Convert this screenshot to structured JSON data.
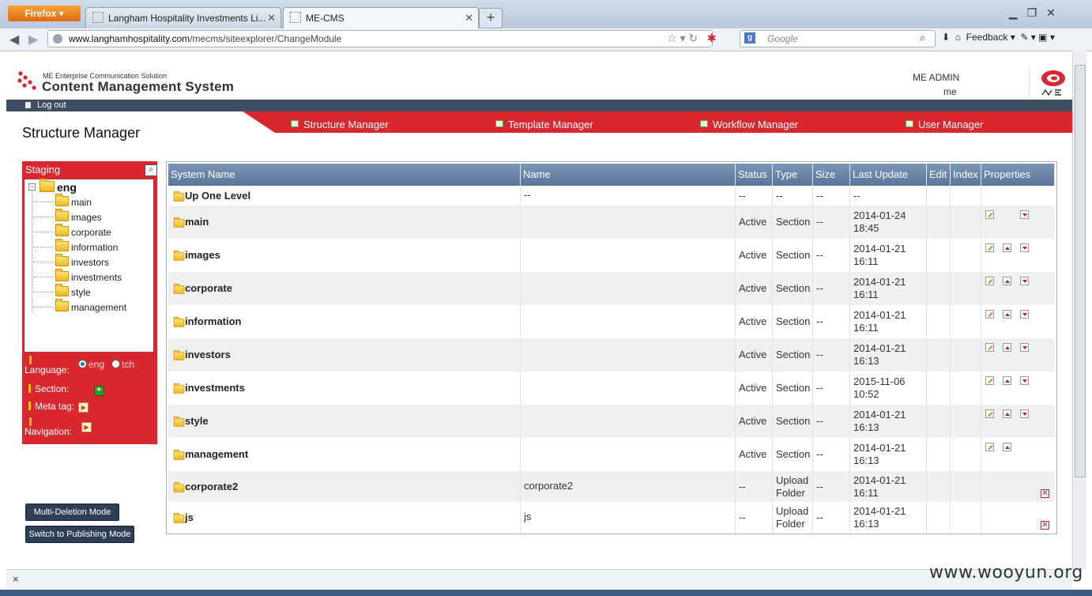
{
  "browser": {
    "firefox_label": "Firefox",
    "tabs": [
      {
        "label": "Langham Hospitality Investments Li..."
      },
      {
        "label": "ME-CMS"
      }
    ],
    "new_tab": "+",
    "url_host": "www.langhamhospitality.com",
    "url_path": "/mecms/siteexplorer/ChangeModule",
    "search_placeholder": "Google",
    "feedback": "Feedback"
  },
  "header": {
    "subtitle": "ME Enterprise Communication Solution",
    "title": "Content Management System",
    "user_name": "ME ADMIN",
    "user_id": "me",
    "logout": "Log out"
  },
  "nav": [
    {
      "label": "Structure Manager"
    },
    {
      "label": "Template Manager"
    },
    {
      "label": "Workflow Manager"
    },
    {
      "label": "User Manager"
    }
  ],
  "page_title": "Structure Manager",
  "staging": {
    "title": "Staging",
    "root": "eng",
    "children": [
      "main",
      "images",
      "corporate",
      "information",
      "investors",
      "investments",
      "style",
      "management"
    ],
    "language_label": "Language:",
    "lang_options": [
      "eng",
      "tch"
    ],
    "lang_selected": "eng",
    "section_label": "Section:",
    "metatag_label": "Meta tag:",
    "navigation_label": "Navigation:"
  },
  "buttons": {
    "multi_delete": "Multi-Deletion Mode",
    "switch_publish": "Switch to Publishing Mode"
  },
  "table": {
    "headers": [
      "System Name",
      "Name",
      "Status",
      "Type",
      "Size",
      "Last Update",
      "Edit",
      "Index",
      "Properties"
    ],
    "rows": [
      {
        "system": "Up One Level",
        "name": "--",
        "status": "--",
        "type": "--",
        "size": "--",
        "date": "--",
        "time": "",
        "props": []
      },
      {
        "system": "main",
        "name": "",
        "status": "Active",
        "type": "Section",
        "size": "--",
        "date": "2014-01-24",
        "time": "18:45",
        "props": [
          "edit",
          "down"
        ]
      },
      {
        "system": "images",
        "name": "",
        "status": "Active",
        "type": "Section",
        "size": "--",
        "date": "2014-01-21",
        "time": "16:11",
        "props": [
          "edit",
          "up",
          "down"
        ]
      },
      {
        "system": "corporate",
        "name": "",
        "status": "Active",
        "type": "Section",
        "size": "--",
        "date": "2014-01-21",
        "time": "16:11",
        "props": [
          "edit",
          "up",
          "down"
        ]
      },
      {
        "system": "information",
        "name": "",
        "status": "Active",
        "type": "Section",
        "size": "--",
        "date": "2014-01-21",
        "time": "16:11",
        "props": [
          "edit",
          "up",
          "down"
        ]
      },
      {
        "system": "investors",
        "name": "",
        "status": "Active",
        "type": "Section",
        "size": "--",
        "date": "2014-01-21",
        "time": "16:13",
        "props": [
          "edit",
          "up",
          "down"
        ]
      },
      {
        "system": "investments",
        "name": "",
        "status": "Active",
        "type": "Section",
        "size": "--",
        "date": "2015-11-06",
        "time": "10:52",
        "props": [
          "edit",
          "up",
          "down"
        ]
      },
      {
        "system": "style",
        "name": "",
        "status": "Active",
        "type": "Section",
        "size": "--",
        "date": "2014-01-21",
        "time": "16:13",
        "props": [
          "edit",
          "up",
          "down"
        ]
      },
      {
        "system": "management",
        "name": "",
        "status": "Active",
        "type": "Section",
        "size": "--",
        "date": "2014-01-21",
        "time": "16:13",
        "props": [
          "edit",
          "up"
        ]
      },
      {
        "system": "corporate2",
        "name": "corporate2",
        "status": "--",
        "type": "Upload",
        "type2": "Folder",
        "size": "--",
        "date": "2014-01-21",
        "time": "16:11",
        "props": [
          "delete"
        ]
      },
      {
        "system": "js",
        "name": "js",
        "status": "--",
        "type": "Upload",
        "type2": "Folder",
        "size": "--",
        "date": "2014-01-21",
        "time": "16:13",
        "props": [
          "delete"
        ]
      }
    ]
  },
  "watermark": "www.wooyun.org",
  "status_close": "×"
}
